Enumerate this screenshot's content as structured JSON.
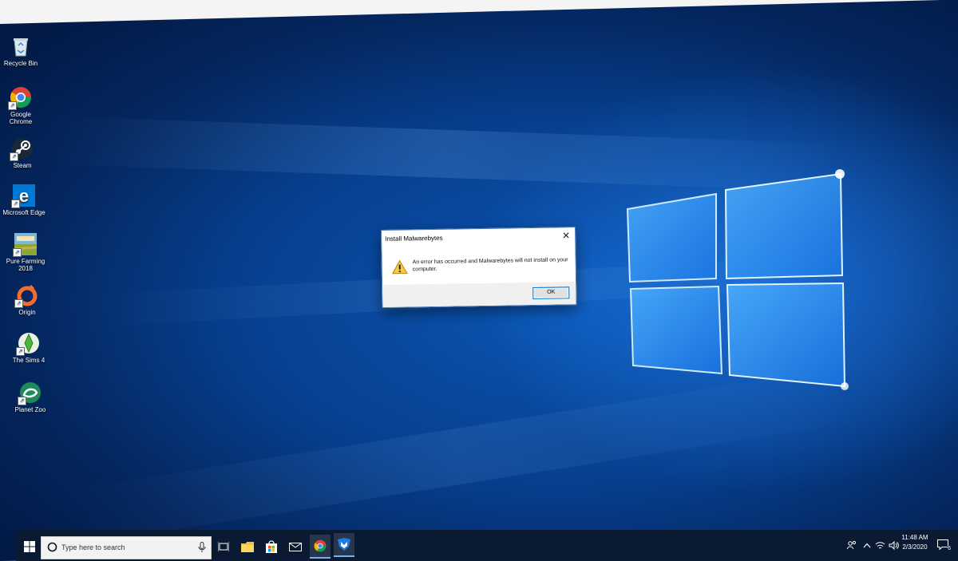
{
  "desktop": {
    "icons": [
      {
        "label": "Recycle Bin",
        "icon": "recycle-bin-icon"
      },
      {
        "label": "Google Chrome",
        "icon": "chrome-icon"
      },
      {
        "label": "Steam",
        "icon": "steam-icon"
      },
      {
        "label": "Microsoft Edge",
        "icon": "edge-icon"
      },
      {
        "label": "Pure Farming 2018",
        "icon": "pure-farming-icon"
      },
      {
        "label": "Origin",
        "icon": "origin-icon"
      },
      {
        "label": "The Sims 4",
        "icon": "sims-icon"
      },
      {
        "label": "Planet Zoo",
        "icon": "planet-zoo-icon"
      }
    ]
  },
  "dialog": {
    "title": "Install Malwarebytes",
    "message": "An error has occurred and Malwarebytes will not install on your computer.",
    "ok_label": "OK",
    "close_symbol": "✕",
    "icon": "warning-icon"
  },
  "taskbar": {
    "search_placeholder": "Type here to search",
    "apps": [
      "task-view-icon",
      "file-explorer-icon",
      "store-icon",
      "mail-icon",
      "chrome-icon",
      "malwarebytes-icon"
    ],
    "tray": {
      "time": "11:48 AM",
      "date": "2/3/2020",
      "notification_count": "6"
    }
  }
}
